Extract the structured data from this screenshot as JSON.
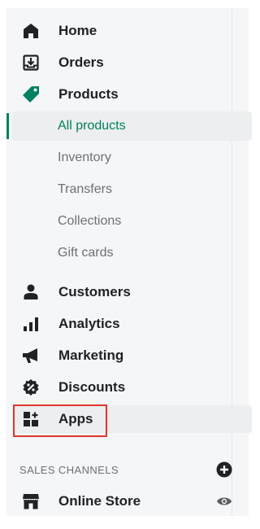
{
  "nav": {
    "home": {
      "label": "Home",
      "icon": "home-icon"
    },
    "orders": {
      "label": "Orders",
      "icon": "orders-icon"
    },
    "products": {
      "label": "Products",
      "icon": "tag-icon"
    },
    "customers": {
      "label": "Customers",
      "icon": "person-icon"
    },
    "analytics": {
      "label": "Analytics",
      "icon": "bar-chart-icon"
    },
    "marketing": {
      "label": "Marketing",
      "icon": "megaphone-icon"
    },
    "discounts": {
      "label": "Discounts",
      "icon": "discount-badge-icon"
    },
    "apps": {
      "label": "Apps",
      "icon": "apps-grid-icon"
    }
  },
  "products_sub": [
    {
      "label": "All products",
      "selected": true
    },
    {
      "label": "Inventory"
    },
    {
      "label": "Transfers"
    },
    {
      "label": "Collections"
    },
    {
      "label": "Gift cards"
    }
  ],
  "sales_channels": {
    "title": "SALES CHANNELS",
    "add_icon": "add-circle-icon",
    "items": [
      {
        "label": "Online Store",
        "icon": "store-icon",
        "action_icon": "eye-icon"
      }
    ]
  },
  "colors": {
    "accent": "#008060",
    "highlight_box": "#e0352b",
    "text": "#202223",
    "muted": "#6d7175"
  }
}
